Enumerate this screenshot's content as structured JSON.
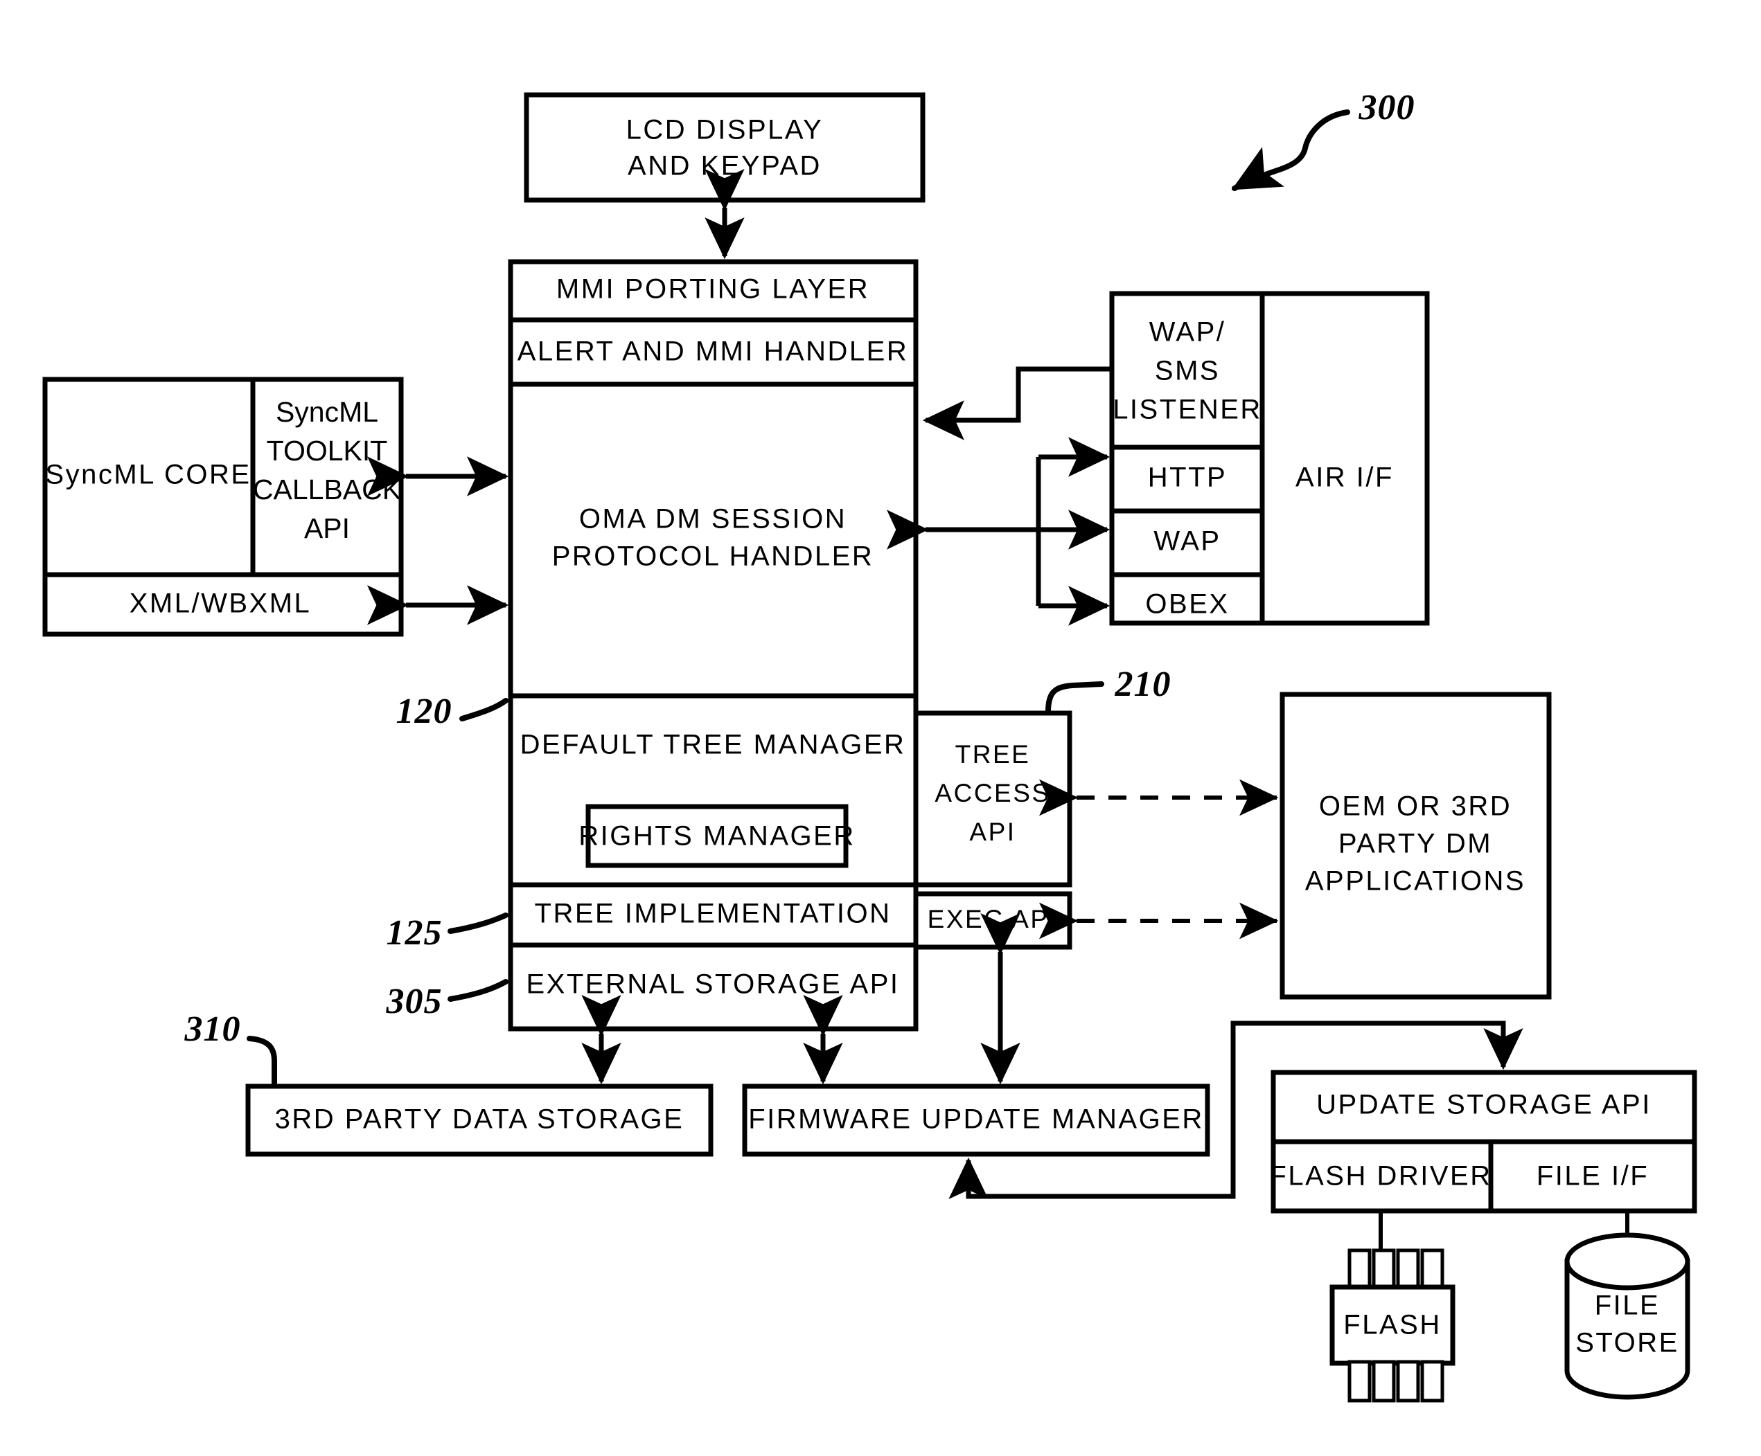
{
  "figure": {
    "ref_main": "300",
    "ref_tree_access": "210",
    "ref_default_tree_manager": "120",
    "ref_tree_implementation": "125",
    "ref_external_storage_api": "305",
    "ref_third_party_data_storage": "310"
  },
  "blocks": {
    "lcd_display": {
      "line1": "LCD DISPLAY",
      "line2": "AND KEYPAD"
    },
    "mmi_porting_layer": "MMI PORTING LAYER",
    "alert_and_mmi_handler": "ALERT AND MMI HANDLER",
    "oma_dm_session": {
      "line1": "OMA DM SESSION",
      "line2": "PROTOCOL HANDLER"
    },
    "syncml_core": "SyncML CORE",
    "syncml_toolkit_callback_api": {
      "line1": "SyncML",
      "line2": "TOOLKIT",
      "line3": "CALLBACK",
      "line4": "API"
    },
    "xml_wbxml": "XML/WBXML",
    "wap_sms_listener": {
      "line1": "WAP/",
      "line2": "SMS",
      "line3": "LISTENER"
    },
    "http": "HTTP",
    "wap": "WAP",
    "obex": "OBEX",
    "air_if": "AIR I/F",
    "default_tree_manager": "DEFAULT TREE MANAGER",
    "rights_manager": "RIGHTS MANAGER",
    "tree_access_api": {
      "line1": "TREE",
      "line2": "ACCESS",
      "line3": "API"
    },
    "tree_implementation": "TREE IMPLEMENTATION",
    "exec_api": "EXEC API",
    "external_storage_api": "EXTERNAL STORAGE API",
    "oem_dm_applications": {
      "line1": "OEM OR 3RD",
      "line2": "PARTY DM",
      "line3": "APPLICATIONS"
    },
    "third_party_data_storage": "3RD PARTY DATA STORAGE",
    "firmware_update_manager": "FIRMWARE UPDATE MANAGER",
    "update_storage_api": "UPDATE STORAGE API",
    "flash_driver": "FLASH DRIVER",
    "file_if": "FILE I/F",
    "flash": "FLASH",
    "file_store": {
      "line1": "FILE",
      "line2": "STORE"
    }
  },
  "colors": {
    "stroke": "#000000",
    "fill": "#ffffff"
  }
}
